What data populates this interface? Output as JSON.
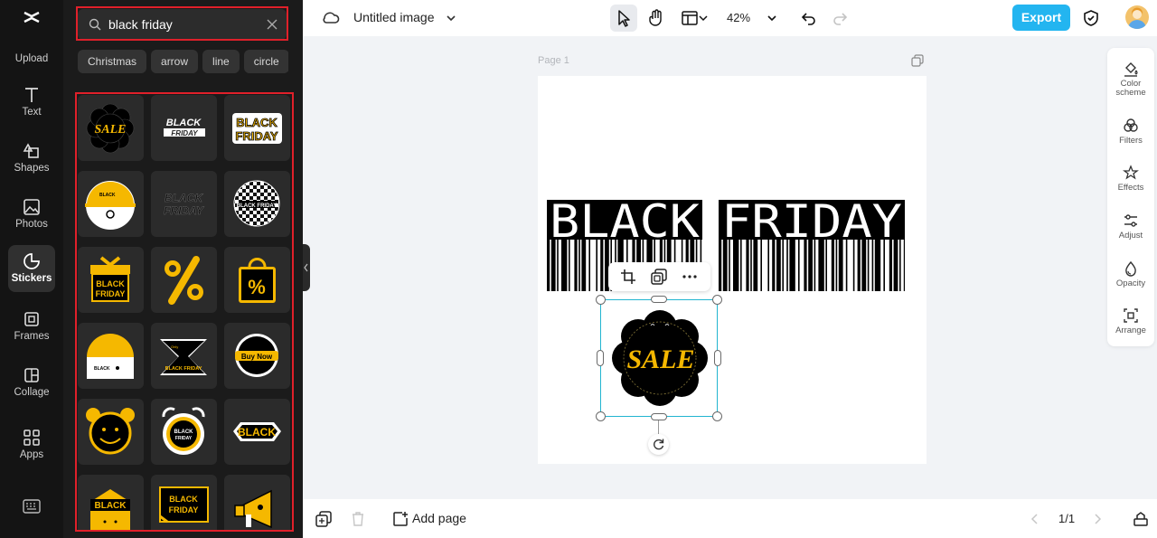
{
  "rail": {
    "items": [
      {
        "label": "Upload",
        "icon": "upload-icon"
      },
      {
        "label": "Text",
        "icon": "text-icon"
      },
      {
        "label": "Shapes",
        "icon": "shapes-icon"
      },
      {
        "label": "Photos",
        "icon": "photos-icon"
      },
      {
        "label": "Stickers",
        "icon": "stickers-icon",
        "active": true
      },
      {
        "label": "Frames",
        "icon": "frames-icon"
      },
      {
        "label": "Collage",
        "icon": "collage-icon"
      },
      {
        "label": "Apps",
        "icon": "apps-icon"
      }
    ]
  },
  "panel": {
    "search_value": "black friday",
    "chips": [
      "Christmas",
      "arrow",
      "line",
      "circle"
    ],
    "stickers": [
      {
        "name": "sale-flower-sticker",
        "text": "SALE"
      },
      {
        "name": "black-friday-brush-sticker",
        "text": "BLACK FRIDAY"
      },
      {
        "name": "black-friday-yellow-sticker",
        "text": "BLACK FRIDAY"
      },
      {
        "name": "yellow-helmet-sticker",
        "text": "BLACK FRIDAY"
      },
      {
        "name": "black-friday-outline-sticker",
        "text": "BLACK FRIDAY"
      },
      {
        "name": "checker-ball-sticker",
        "text": "BLACK FRIDAY"
      },
      {
        "name": "gift-box-sticker",
        "text": "BLACK FRIDAY"
      },
      {
        "name": "percent-sticker",
        "text": "%"
      },
      {
        "name": "shopping-bag-sticker",
        "text": "%"
      },
      {
        "name": "yellow-dome-sticker",
        "text": "BLACK"
      },
      {
        "name": "hourglass-sticker",
        "text": "BLACK FRIDAY"
      },
      {
        "name": "buy-now-badge-sticker",
        "text": "Buy Now"
      },
      {
        "name": "alarm-face-sticker",
        "text": ""
      },
      {
        "name": "alarm-clock-sticker",
        "text": "BLACK FRIDAY"
      },
      {
        "name": "black-pill-sticker",
        "text": "BLACK"
      },
      {
        "name": "envelope-sticker",
        "text": "BLACK"
      },
      {
        "name": "black-friday-frame-sticker",
        "text": "BLACK FRIDAY"
      },
      {
        "name": "megaphone-sticker",
        "text": ""
      }
    ]
  },
  "topbar": {
    "title": "Untitled image",
    "zoom": "42%",
    "export_label": "Export"
  },
  "canvas": {
    "page_label": "Page 1",
    "headline_word1": "BLACK",
    "headline_word2": "FRIDAY",
    "sale_text": "SALE"
  },
  "right_tools": [
    {
      "label": "Color scheme",
      "icon": "color-scheme-icon"
    },
    {
      "label": "Filters",
      "icon": "filters-icon"
    },
    {
      "label": "Effects",
      "icon": "effects-icon"
    },
    {
      "label": "Adjust",
      "icon": "adjust-icon"
    },
    {
      "label": "Opacity",
      "icon": "opacity-icon"
    },
    {
      "label": "Arrange",
      "icon": "arrange-icon"
    }
  ],
  "bottombar": {
    "add_page_label": "Add page",
    "page_indicator": "1/1"
  },
  "colors": {
    "accent": "#23b5f0",
    "selection": "#22b5d0",
    "highlight_box": "#e0202a",
    "sticker_yellow": "#f5b800"
  }
}
